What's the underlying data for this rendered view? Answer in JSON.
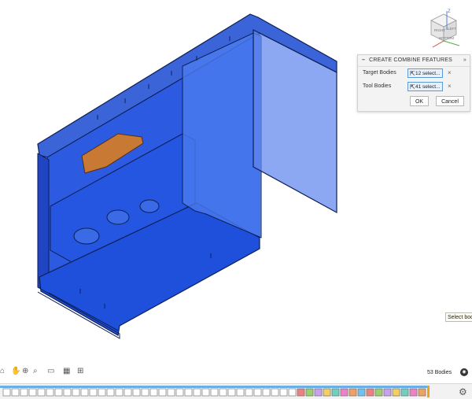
{
  "panel": {
    "title": "CREATE COMBINE FEATURES",
    "collapse_glyph": "»",
    "target_label": "Target Bodies",
    "target_value": "12 select...",
    "tool_label": "Tool Bodies",
    "tool_value": "41 select...",
    "ok_label": "OK",
    "cancel_label": "Cancel",
    "clear_glyph": "×"
  },
  "tooltip": "Select bod",
  "status": {
    "bodies_count": "53 Bodies"
  },
  "viewcube": {
    "faces": [
      "RIGHT",
      "LEFT",
      "BOTTOM"
    ],
    "axis": "Z"
  },
  "navbar": {
    "icons": [
      "orbit-icon",
      "pan-icon",
      "zoom-icon",
      "fit-icon",
      "display-icon",
      "grid-icon",
      "viewports-icon"
    ]
  },
  "timeline": {
    "feature_count": 49,
    "colors": {
      "feature": "#8a8a8a",
      "accent": "#6ab0e6",
      "marker": "#f0a020"
    }
  },
  "colors": {
    "body": "#2a5bd8",
    "body_dark": "#1a3a8f",
    "orange": "#c87933",
    "panel_bg": "#f3f3f3"
  }
}
